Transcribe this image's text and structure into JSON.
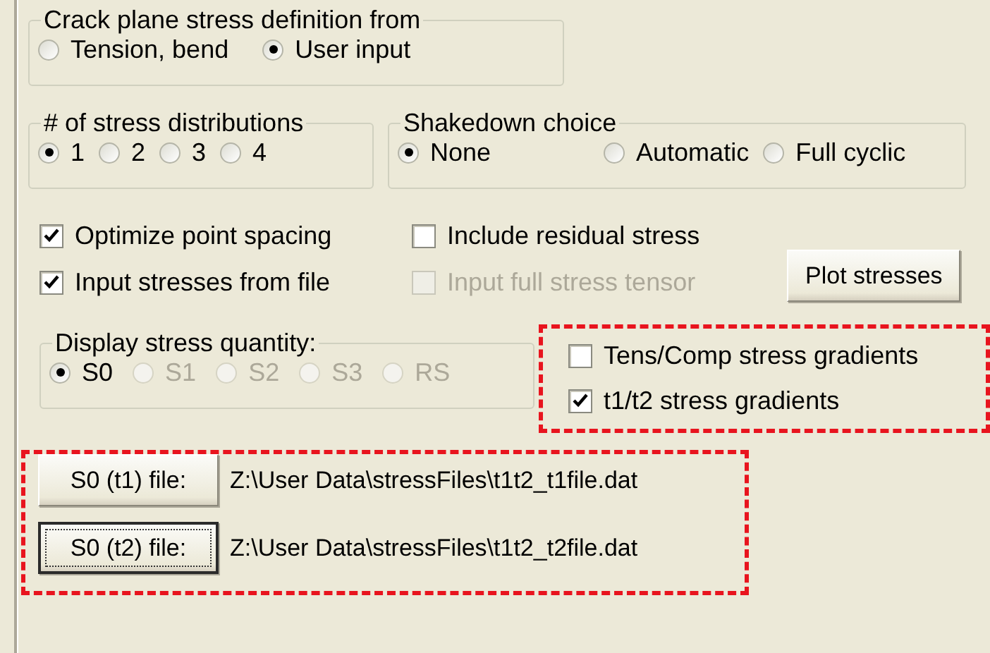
{
  "crack_plane_stress": {
    "title": "Crack plane stress definition from",
    "options": [
      {
        "label": "Tension, bend",
        "selected": false,
        "disabled": false
      },
      {
        "label": "User input",
        "selected": true,
        "disabled": false
      }
    ]
  },
  "stress_distributions": {
    "title": "# of stress distributions",
    "options": [
      {
        "label": "1",
        "selected": true,
        "disabled": false
      },
      {
        "label": "2",
        "selected": false,
        "disabled": false
      },
      {
        "label": "3",
        "selected": false,
        "disabled": false
      },
      {
        "label": "4",
        "selected": false,
        "disabled": false
      }
    ]
  },
  "shakedown_choice": {
    "title": "Shakedown choice",
    "options": [
      {
        "label": "None",
        "selected": true,
        "disabled": false
      },
      {
        "label": "Automatic",
        "selected": false,
        "disabled": false
      },
      {
        "label": "Full cyclic",
        "selected": false,
        "disabled": false
      }
    ]
  },
  "checkboxes": [
    {
      "label": "Optimize point spacing",
      "checked": true,
      "disabled": false
    },
    {
      "label": "Include residual stress",
      "checked": false,
      "disabled": false
    },
    {
      "label": "Input stresses from file",
      "checked": true,
      "disabled": false
    },
    {
      "label": "Input full stress tensor",
      "checked": false,
      "disabled": true
    }
  ],
  "plot_button": {
    "label": "Plot stresses"
  },
  "display_stress_quantity": {
    "title": "Display stress quantity:",
    "options": [
      {
        "label": "S0",
        "selected": true,
        "disabled": false
      },
      {
        "label": "S1",
        "selected": false,
        "disabled": true
      },
      {
        "label": "S2",
        "selected": false,
        "disabled": true
      },
      {
        "label": "S3",
        "selected": false,
        "disabled": true
      },
      {
        "label": "RS",
        "selected": false,
        "disabled": true
      }
    ]
  },
  "gradient_options": {
    "highlighted": true,
    "items": [
      {
        "label": "Tens/Comp stress gradients",
        "checked": false,
        "disabled": false
      },
      {
        "label": "t1/t2 stress gradients",
        "checked": true,
        "disabled": false
      }
    ]
  },
  "file_inputs": {
    "highlighted": true,
    "rows": [
      {
        "button": "S0 (t1) file:",
        "focused": false,
        "path": "Z:\\User Data\\stressFiles\\t1t2_t1file.dat"
      },
      {
        "button": "S0 (t2) file:",
        "focused": true,
        "path": "Z:\\User Data\\stressFiles\\t1t2_t2file.dat"
      }
    ]
  }
}
